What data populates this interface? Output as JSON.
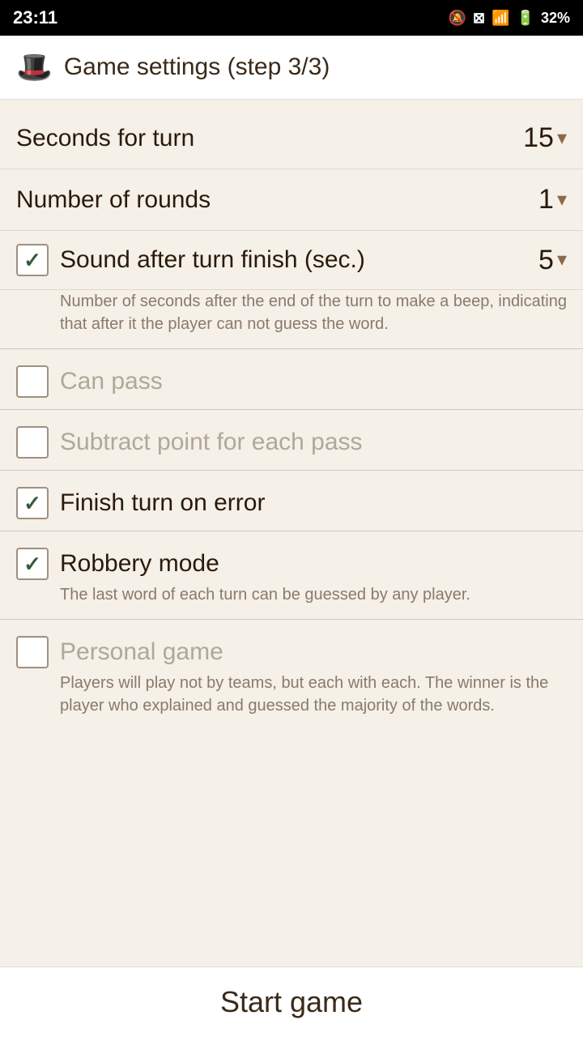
{
  "statusBar": {
    "time": "23:11",
    "battery": "32%"
  },
  "header": {
    "icon": "🎩",
    "title": "Game settings (step 3/3)"
  },
  "settings": {
    "secondsForTurn": {
      "label": "Seconds for turn",
      "value": "15"
    },
    "numberOfRounds": {
      "label": "Number of rounds",
      "value": "1"
    }
  },
  "checkboxes": {
    "soundAfterTurn": {
      "label": "Sound after turn finish (sec.)",
      "checked": true,
      "value": "5",
      "description": "Number of seconds after the end of the turn to make a beep, indicating that after it the player can not guess the word."
    },
    "canPass": {
      "label": "Can pass",
      "checked": false,
      "disabled": true
    },
    "subtractPoint": {
      "label": "Subtract point for each pass",
      "checked": false,
      "disabled": true
    },
    "finishTurnOnError": {
      "label": "Finish turn on error",
      "checked": true,
      "disabled": false
    },
    "robberyMode": {
      "label": "Robbery mode",
      "checked": true,
      "disabled": false,
      "description": "The last word of each turn can be guessed by any player."
    },
    "personalGame": {
      "label": "Personal game",
      "checked": false,
      "disabled": true,
      "description": "Players will play not by teams, but each with each. The winner is the player who explained and guessed the majority of the words."
    }
  },
  "footer": {
    "startGameLabel": "Start game"
  }
}
